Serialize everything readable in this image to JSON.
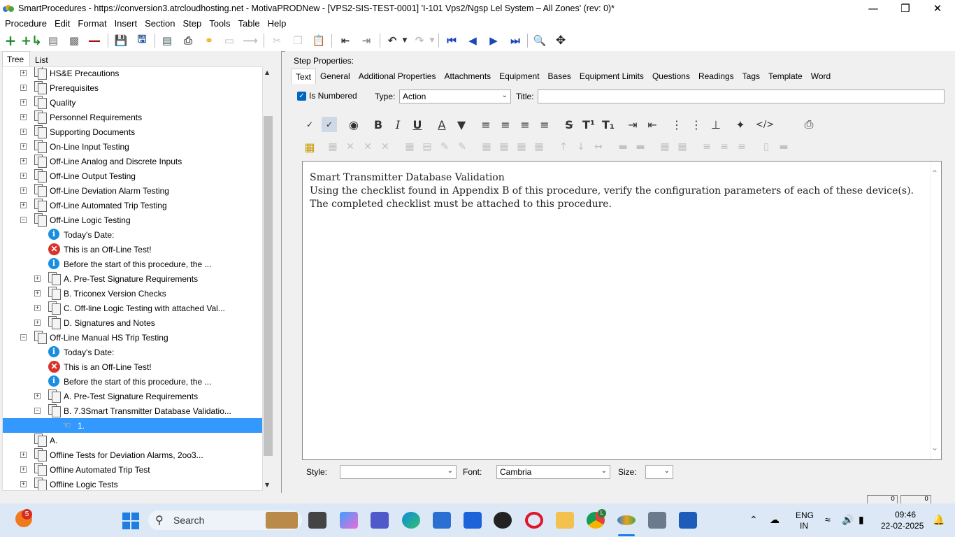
{
  "window": {
    "title": "SmartProcedures - https://conversion3.atrcloudhosting.net - MotivaPRODNew - [VPS2-SIS-TEST-0001] 'I-101 Vps2/Ngsp Lel System – All Zones' (rev: 0)*"
  },
  "menu": [
    "Procedure",
    "Edit",
    "Format",
    "Insert",
    "Section",
    "Step",
    "Tools",
    "Table",
    "Help"
  ],
  "left_tabs": [
    "Tree",
    "List"
  ],
  "tree": [
    {
      "label": "HS&E Precautions",
      "type": "doc",
      "level": 0,
      "expander": "+"
    },
    {
      "label": "Prerequisites",
      "type": "doc",
      "level": 0,
      "expander": "+"
    },
    {
      "label": "Quality",
      "type": "doc",
      "level": 0,
      "expander": "+"
    },
    {
      "label": "Personnel Requirements",
      "type": "doc",
      "level": 0,
      "expander": "+"
    },
    {
      "label": "Supporting Documents",
      "type": "doc",
      "level": 0,
      "expander": "+"
    },
    {
      "label": "On-Line Input Testing",
      "type": "doc",
      "level": 0,
      "expander": "+"
    },
    {
      "label": "Off-Line Analog and Discrete Inputs",
      "type": "doc",
      "level": 0,
      "expander": "+"
    },
    {
      "label": "Off-Line Output Testing",
      "type": "doc",
      "level": 0,
      "expander": "+"
    },
    {
      "label": "Off-Line Deviation Alarm Testing",
      "type": "doc",
      "level": 0,
      "expander": "+"
    },
    {
      "label": "Off-Line Automated Trip Testing",
      "type": "doc",
      "level": 0,
      "expander": "+"
    },
    {
      "label": "Off-Line Logic Testing",
      "type": "doc",
      "level": 0,
      "expander": "−"
    },
    {
      "label": "Today's Date:",
      "type": "info",
      "level": 1,
      "expander": ""
    },
    {
      "label": "This is an Off-Line Test!",
      "type": "error",
      "level": 1,
      "expander": ""
    },
    {
      "label": "Before the start of this procedure, the ...",
      "type": "info",
      "level": 1,
      "expander": ""
    },
    {
      "label": "A. Pre-Test Signature Requirements",
      "type": "doc",
      "level": 1,
      "expander": "+"
    },
    {
      "label": "B. Triconex Version Checks",
      "type": "doc",
      "level": 1,
      "expander": "+"
    },
    {
      "label": "C. Off-line Logic Testing with attached Val...",
      "type": "doc",
      "level": 1,
      "expander": "+"
    },
    {
      "label": "D. Signatures and Notes",
      "type": "doc",
      "level": 1,
      "expander": "+"
    },
    {
      "label": "Off-Line Manual HS Trip Testing",
      "type": "doc",
      "level": 0,
      "expander": "−"
    },
    {
      "label": "Today's Date:",
      "type": "info",
      "level": 1,
      "expander": ""
    },
    {
      "label": "This is an Off-Line Test!",
      "type": "error",
      "level": 1,
      "expander": ""
    },
    {
      "label": "Before the start of this procedure, the ...",
      "type": "info",
      "level": 1,
      "expander": ""
    },
    {
      "label": "A. Pre-Test Signature Requirements",
      "type": "doc",
      "level": 1,
      "expander": "+"
    },
    {
      "label": "B. 7.3Smart Transmitter Database Validatio...",
      "type": "doc",
      "level": 1,
      "expander": "−"
    },
    {
      "label": "1.",
      "type": "hand",
      "level": 2,
      "expander": "",
      "selected": true
    },
    {
      "label": "A.",
      "type": "doc",
      "level": 0,
      "expander": ""
    },
    {
      "label": "Offline Tests for Deviation Alarms, 2oo3...",
      "type": "doc",
      "level": 0,
      "expander": "+"
    },
    {
      "label": "Offline Automated Trip Test",
      "type": "doc",
      "level": 0,
      "expander": "+"
    },
    {
      "label": "Offline Logic Tests",
      "type": "doc",
      "level": 0,
      "expander": "+"
    }
  ],
  "step": {
    "title": "Step Properties:",
    "tabs": [
      "Text",
      "General",
      "Additional Properties",
      "Attachments",
      "Equipment",
      "Bases",
      "Equipment Limits",
      "Questions",
      "Readings",
      "Tags",
      "Template",
      "Word"
    ],
    "active_tab": "Text",
    "is_numbered_label": "Is Numbered",
    "is_numbered": true,
    "type_label": "Type:",
    "type_value": "Action",
    "title_label": "Title:",
    "title_value": "",
    "editor_line1": "Smart Transmitter Database Validation",
    "editor_line2": "Using the checklist found in Appendix B of this procedure, verify the configuration parameters of each of these device(s). The completed checklist must be attached to this procedure.",
    "style_label": "Style:",
    "style_value": "",
    "font_label": "Font:",
    "font_value": "Cambria",
    "size_label": "Size:",
    "size_value": ""
  },
  "status": {
    "box1": "0",
    "box2": "0"
  },
  "taskbar": {
    "search_label": "Search",
    "notification_count": "5",
    "language_line1": "ENG",
    "language_line2": "IN",
    "time": "09:46",
    "date": "22-02-2025",
    "chrome_badge": "L"
  }
}
